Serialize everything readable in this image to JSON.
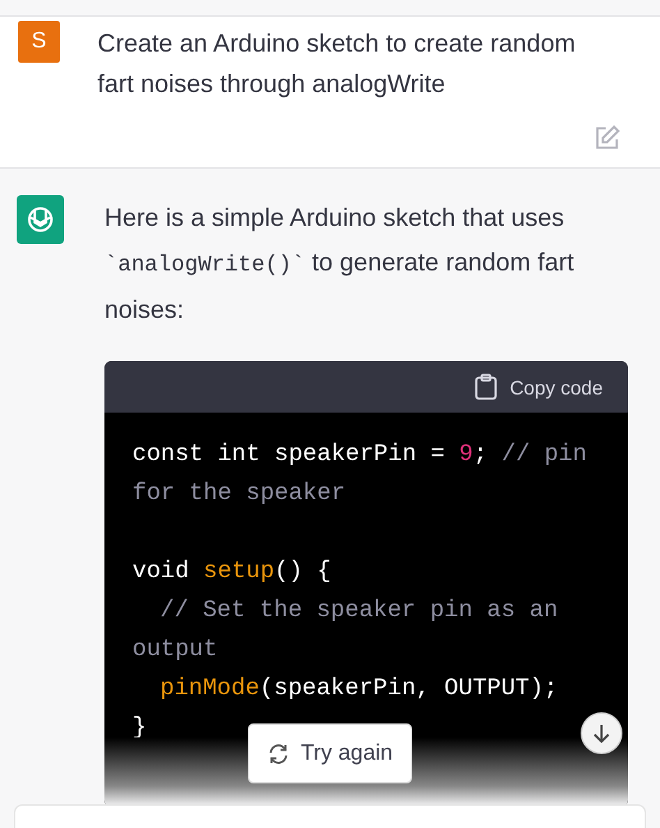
{
  "user_message": {
    "avatar_letter": "S",
    "text": "Create an Arduino sketch to create random fart noises through analogWrite"
  },
  "assistant_message": {
    "intro": [
      {
        "kind": "text",
        "text": "Here is a simple Arduino sketch that uses "
      },
      {
        "kind": "code",
        "text": "`analogWrite()`"
      },
      {
        "kind": "text",
        "text": " to generate random fart noises:"
      }
    ],
    "code_block": {
      "copy_label": "Copy code",
      "lines": [
        {
          "indented": false,
          "gap_before": false,
          "tokens": [
            {
              "kind": "plain",
              "text": "const int speakerPin = "
            },
            {
              "kind": "number",
              "text": "9"
            },
            {
              "kind": "plain",
              "text": "; "
            },
            {
              "kind": "comment",
              "text": "// pin for the speaker"
            }
          ]
        },
        {
          "indented": false,
          "gap_before": true,
          "tokens": [
            {
              "kind": "plain",
              "text": "void "
            },
            {
              "kind": "function",
              "text": "setup"
            },
            {
              "kind": "plain",
              "text": "() {"
            }
          ]
        },
        {
          "indented": true,
          "gap_before": false,
          "tokens": [
            {
              "kind": "comment",
              "text": "// Set the speaker pin as an output"
            }
          ]
        },
        {
          "indented": true,
          "gap_before": false,
          "tokens": [
            {
              "kind": "function",
              "text": "pinMode"
            },
            {
              "kind": "plain",
              "text": "(speakerPin, OUTPUT);"
            }
          ]
        },
        {
          "indented": false,
          "gap_before": false,
          "tokens": [
            {
              "kind": "plain",
              "text": "}"
            }
          ]
        }
      ]
    }
  },
  "try_again_button": {
    "label": "Try again"
  }
}
